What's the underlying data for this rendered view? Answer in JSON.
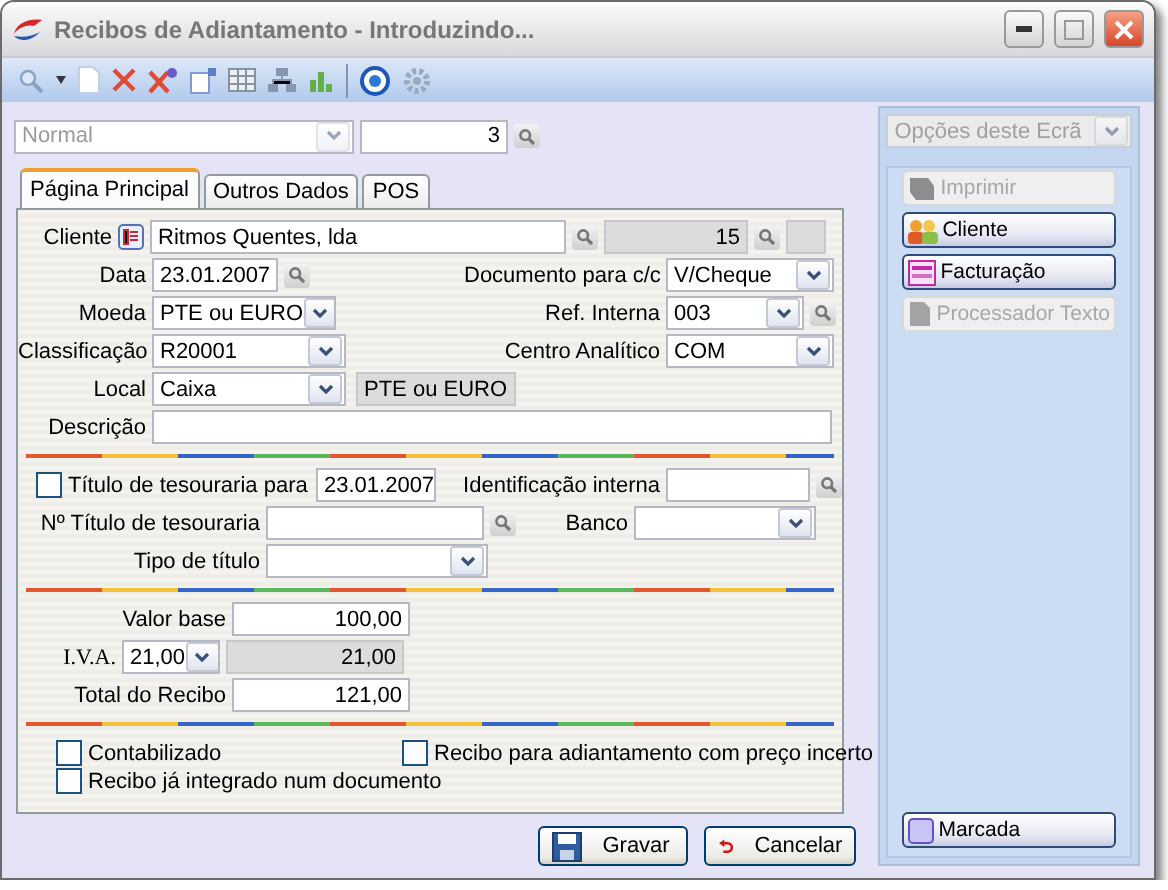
{
  "window": {
    "title": "Recibos de Adiantamento - Introduzindo..."
  },
  "header": {
    "series": {
      "value": "Normal",
      "disabled": true
    },
    "number": "3"
  },
  "tabs": [
    {
      "label": "Página Principal",
      "selected": true
    },
    {
      "label": "Outros Dados",
      "selected": false
    },
    {
      "label": "POS",
      "selected": false
    }
  ],
  "form": {
    "cliente": {
      "label": "Cliente",
      "value": "Ritmos Quentes, lda",
      "number": "15"
    },
    "data": {
      "label": "Data",
      "value": "23.01.2007"
    },
    "documento": {
      "label": "Documento para c/c",
      "value": "V/Cheque"
    },
    "moeda": {
      "label": "Moeda",
      "value": "PTE ou EURO"
    },
    "ref_interna": {
      "label": "Ref. Interna",
      "value": "003"
    },
    "classificacao": {
      "label": "Classificação",
      "value": "R20001"
    },
    "centro_analitico": {
      "label": "Centro Analítico",
      "value": "COM"
    },
    "local": {
      "label": "Local",
      "value": "Caixa",
      "currency": "PTE ou EURO"
    },
    "descricao": {
      "label": "Descrição"
    },
    "titulo_tesouraria": {
      "label": "Título de tesouraria para",
      "checked": false,
      "value": "23.01.2007"
    },
    "identificacao_interna": {
      "label": "Identificação interna"
    },
    "numero_titulo": {
      "label": "Nº Título de tesouraria"
    },
    "banco": {
      "label": "Banco"
    },
    "tipo_titulo": {
      "label": "Tipo de título"
    },
    "valor_base": {
      "label": "Valor base",
      "value": "100,00"
    },
    "iva": {
      "label": "I.V.A.",
      "rate": "21,00",
      "value": "21,00"
    },
    "total": {
      "label": "Total do Recibo",
      "value": "121,00"
    },
    "checkboxes": [
      {
        "label": "Contabilizado",
        "checked": false
      },
      {
        "label": "Recibo para adiantamento com preço incerto",
        "checked": false
      },
      {
        "label": "Recibo já integrado num documento",
        "checked": false
      }
    ]
  },
  "buttons": [
    {
      "label": "Gravar",
      "kind": "save"
    },
    {
      "label": "Cancelar",
      "kind": "cancel"
    }
  ],
  "options": {
    "title": "Opções deste Ecrã",
    "buttons": [
      {
        "label": "Imprimir",
        "kind": "print",
        "disabled": true
      },
      {
        "label": "Cliente",
        "kind": "client",
        "disabled": false
      },
      {
        "label": "Facturação",
        "kind": "invoice",
        "disabled": false
      },
      {
        "label": "Processador Texto",
        "kind": "text",
        "disabled": true
      }
    ],
    "bottom": {
      "label": "Marcada",
      "kind": "mark",
      "disabled": false
    }
  }
}
